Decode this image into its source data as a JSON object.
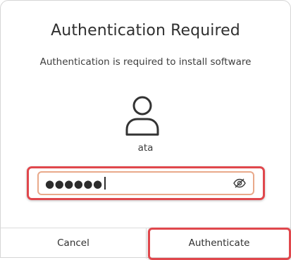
{
  "dialog": {
    "title": "Authentication Required",
    "message": "Authentication is required to install software"
  },
  "user": {
    "avatar_icon": "user-avatar-icon",
    "name": "ata"
  },
  "password": {
    "masked_value": "●●●●●●",
    "reveal_icon": "eye-crossed-icon"
  },
  "buttons": {
    "cancel_label": "Cancel",
    "authenticate_label": "Authenticate"
  },
  "colors": {
    "highlight": "#e0474c",
    "focus_border": "#e9a98a"
  }
}
